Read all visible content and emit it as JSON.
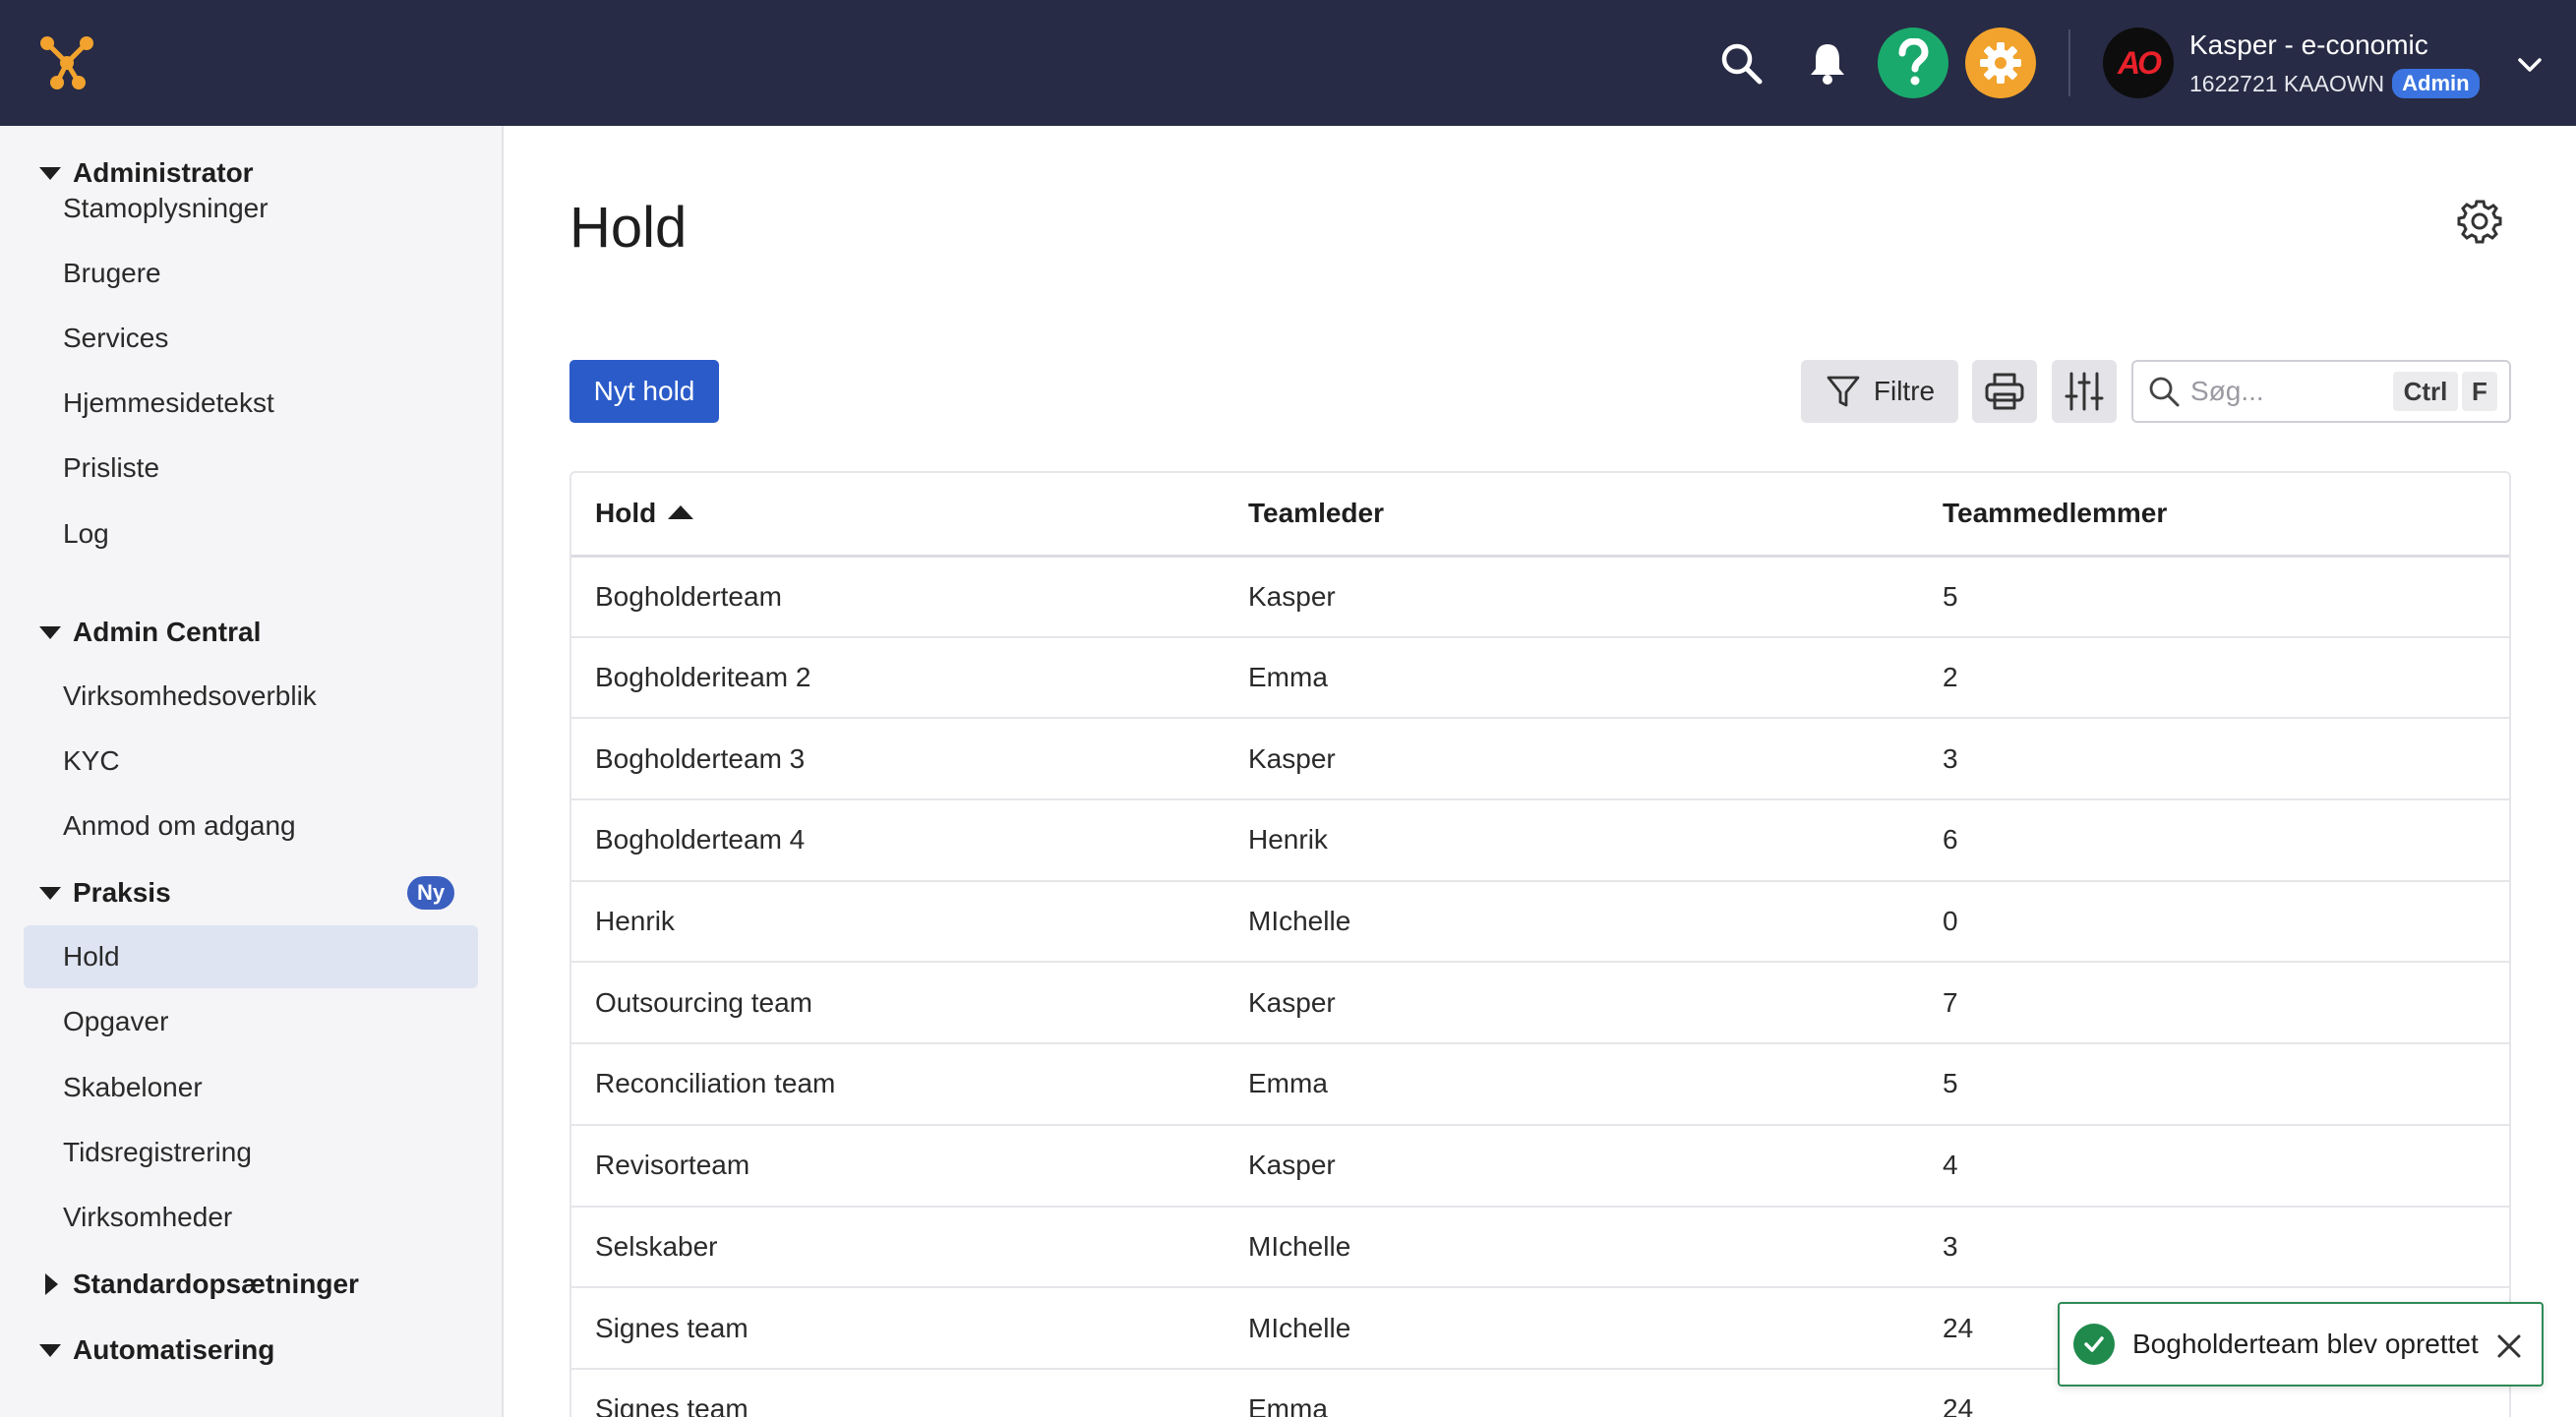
{
  "topbar": {
    "user_name": "Kasper - e-conomic",
    "account_meta": "1622721 KAAOWN",
    "role_badge": "Admin",
    "avatar_text": "AO"
  },
  "sidebar": {
    "sections": [
      {
        "label": "Administrator",
        "expanded": true,
        "items": [
          "Stamoplysninger",
          "Brugere",
          "Services",
          "Hjemmesidetekst",
          "Prisliste",
          "Log"
        ]
      },
      {
        "label": "Admin Central",
        "expanded": true,
        "items": [
          "Virksomhedsoverblik",
          "KYC",
          "Anmod om adgang"
        ]
      },
      {
        "label": "Praksis",
        "expanded": true,
        "badge": "Ny",
        "items": [
          "Hold",
          "Opgaver",
          "Skabeloner",
          "Tidsregistrering",
          "Virksomheder"
        ]
      },
      {
        "label": "Standardopsætninger",
        "expanded": false,
        "items": []
      },
      {
        "label": "Automatisering",
        "expanded": true,
        "items": []
      }
    ],
    "active_item": "Hold"
  },
  "main": {
    "title": "Hold",
    "new_button": "Nyt hold",
    "filter_button": "Filtre",
    "search_placeholder": "Søg...",
    "shortcut_ctrl": "Ctrl",
    "shortcut_key": "F",
    "columns": [
      "Hold",
      "Teamleder",
      "Teammedlemmer"
    ],
    "sort": {
      "column": "Hold",
      "direction": "ascending"
    },
    "rows": [
      [
        "Bogholderteam",
        "Kasper",
        "5"
      ],
      [
        "Bogholderiteam 2",
        "Emma",
        "2"
      ],
      [
        "Bogholderteam 3",
        "Kasper",
        "3"
      ],
      [
        "Bogholderteam 4",
        "Henrik",
        "6"
      ],
      [
        "Henrik",
        "MIchelle",
        "0"
      ],
      [
        "Outsourcing team",
        "Kasper",
        "7"
      ],
      [
        "Reconciliation team",
        "Emma",
        "5"
      ],
      [
        "Revisorteam",
        "Kasper",
        "4"
      ],
      [
        "Selskaber",
        "MIchelle",
        "3"
      ],
      [
        "Signes team",
        "MIchelle",
        "24"
      ],
      [
        "Signes team",
        "Emma",
        "24"
      ]
    ]
  },
  "toast": {
    "message": "Bogholderteam blev oprettet"
  },
  "colors": {
    "topbar": "#272b45",
    "primary": "#2a5bc9",
    "help": "#1aa96c",
    "settings": "#f2a32d",
    "success": "#1f8a4c"
  }
}
